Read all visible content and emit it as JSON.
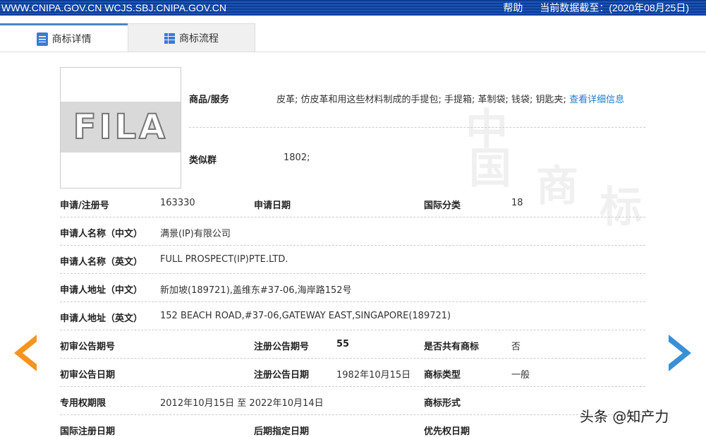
{
  "topbar": {
    "sites": "WWW.CNIPA.GOV.CN WCJS.SBJ.CNIPA.GOV.CN",
    "help": "帮助",
    "data_date": "当前数据截至：(2020年08月25日)"
  },
  "tabs": [
    {
      "label": "商标详情"
    },
    {
      "label": "商标流程"
    }
  ],
  "logo_text": "FILA",
  "goods": {
    "label": "商品/服务",
    "value": "皮革; 仿皮革和用这些材料制成的手提包; 手提箱; 革制袋; 钱袋; 钥匙夹;",
    "link": "查看详细信息"
  },
  "similar": {
    "label": "类似群",
    "value": "1802;"
  },
  "rows": {
    "reg_no": {
      "label": "申请/注册号",
      "value": "163330"
    },
    "app_date": {
      "label": "申请日期",
      "value": ""
    },
    "intl_class": {
      "label": "国际分类",
      "value": "18"
    },
    "applicant_cn": {
      "label": "申请人名称（中文）",
      "value": "满景(IP)有限公司"
    },
    "applicant_en": {
      "label": "申请人名称（英文）",
      "value": "FULL PROSPECT(IP)PTE.LTD."
    },
    "addr_cn": {
      "label": "申请人地址（中文）",
      "value": "新加坡(189721),盖维东#37-06,海岸路152号"
    },
    "addr_en": {
      "label": "申请人地址（英文）",
      "value": "152 BEACH ROAD,#37-06,GATEWAY EAST,SINGAPORE(189721)"
    },
    "prelim_no": {
      "label": "初审公告期号",
      "value": ""
    },
    "reg_pub_no": {
      "label": "注册公告期号",
      "value": "55"
    },
    "shared": {
      "label": "是否共有商标",
      "value": "否"
    },
    "prelim_date": {
      "label": "初审公告日期",
      "value": ""
    },
    "reg_pub_date": {
      "label": "注册公告日期",
      "value": "1982年10月15日"
    },
    "tm_type": {
      "label": "商标类型",
      "value": "一般"
    },
    "exclusive": {
      "label": "专用权期限",
      "value": "2012年10月15日 至 2022年10月14日"
    },
    "tm_form": {
      "label": "商标形式",
      "value": ""
    },
    "intl_reg_date": {
      "label": "国际注册日期",
      "value": ""
    },
    "later_date": {
      "label": "后期指定日期",
      "value": ""
    },
    "priority_date": {
      "label": "优先权日期",
      "value": ""
    }
  },
  "credit": "头条 @知产力",
  "colors": {
    "topbar": "#0a3c96",
    "link": "#1a7ccc",
    "prev": "#f7941d",
    "next": "#3b8fd6"
  }
}
